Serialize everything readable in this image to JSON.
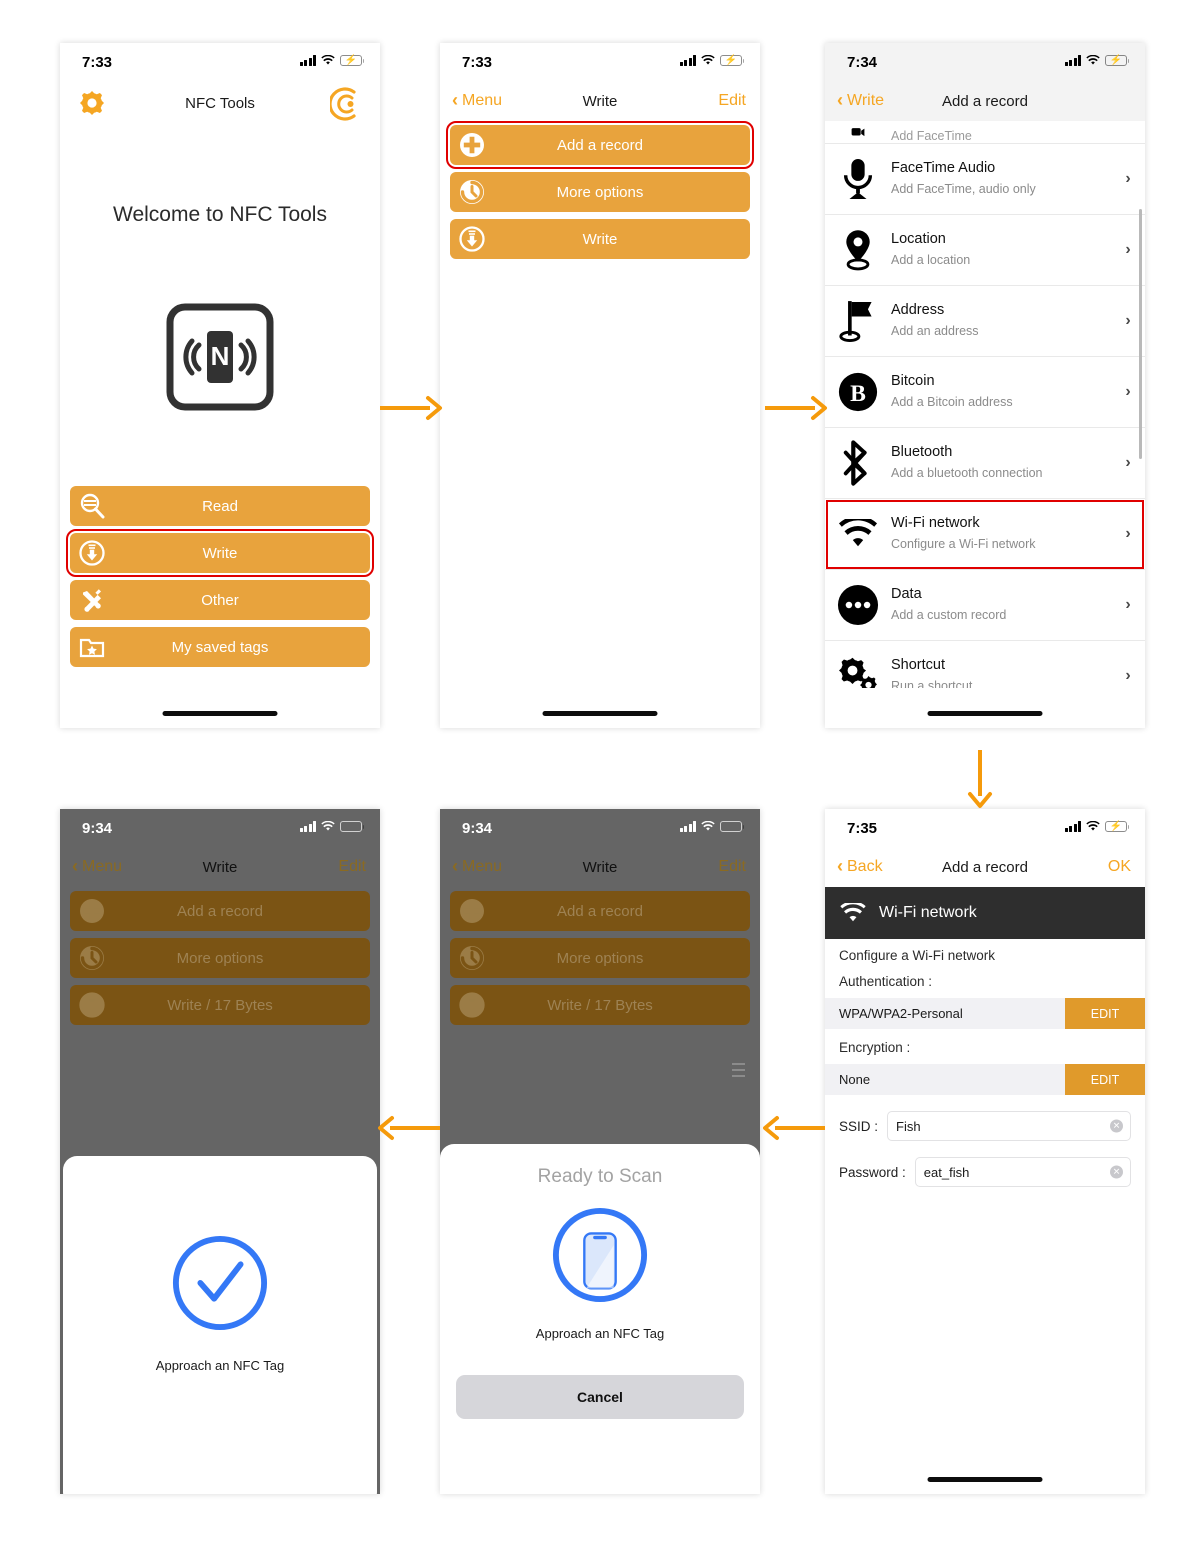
{
  "flow": {
    "arrows": [
      {
        "name": "arrow-screen1-to-screen2",
        "dir": "right"
      },
      {
        "name": "arrow-screen2-to-screen3",
        "dir": "right"
      },
      {
        "name": "arrow-screen3-to-screen4",
        "dir": "down"
      },
      {
        "name": "arrow-screen4-to-screen5",
        "dir": "left"
      },
      {
        "name": "arrow-screen5-to-screen6",
        "dir": "left"
      }
    ]
  },
  "screen1": {
    "status": {
      "time": "7:33",
      "signal_icon": "cellular-bars-icon",
      "wifi_icon": "wifi-icon",
      "battery_icon": "battery-charging-icon"
    },
    "gear_icon": "gear-icon",
    "brand_icon": "nfc-brand-icon",
    "app_title": "NFC Tools",
    "welcome": "Welcome to NFC Tools",
    "logo_icon": "nfc-tag-logo-icon",
    "logo_letter": "N",
    "buttons": [
      {
        "label": "Read",
        "icon": "magnifier-read-icon",
        "highlighted": false
      },
      {
        "label": "Write",
        "icon": "download-arrow-write-icon",
        "highlighted": true
      },
      {
        "label": "Other",
        "icon": "tools-wrench-screwdriver-icon",
        "highlighted": false
      },
      {
        "label": "My saved tags",
        "icon": "folder-star-icon",
        "highlighted": false
      }
    ]
  },
  "screen2": {
    "status": {
      "time": "7:33"
    },
    "nav": {
      "back": "Menu",
      "title": "Write",
      "right": "Edit"
    },
    "buttons": [
      {
        "label": "Add a record",
        "icon": "plus-circle-icon",
        "highlighted": true
      },
      {
        "label": "More options",
        "icon": "options-circle-icon",
        "highlighted": false
      },
      {
        "label": "Write",
        "icon": "download-arrow-write-icon",
        "highlighted": false
      }
    ]
  },
  "screen3": {
    "status": {
      "time": "7:34"
    },
    "nav": {
      "back": "Write",
      "title": "Add a record"
    },
    "partial_row": {
      "subtitle": "Add FaceTime"
    },
    "rows": [
      {
        "title": "FaceTime Audio",
        "subtitle": "Add FaceTime, audio only",
        "icon": "microphone-icon",
        "highlighted": false
      },
      {
        "title": "Location",
        "subtitle": "Add a location",
        "icon": "map-pin-icon",
        "highlighted": false
      },
      {
        "title": "Address",
        "subtitle": "Add an address",
        "icon": "flag-icon",
        "highlighted": false
      },
      {
        "title": "Bitcoin",
        "subtitle": "Add a Bitcoin address",
        "icon": "bitcoin-icon",
        "highlighted": false
      },
      {
        "title": "Bluetooth",
        "subtitle": "Add a bluetooth connection",
        "icon": "bluetooth-icon",
        "highlighted": false
      },
      {
        "title": "Wi-Fi network",
        "subtitle": "Configure a Wi-Fi network",
        "icon": "wifi-icon",
        "highlighted": true
      },
      {
        "title": "Data",
        "subtitle": "Add a custom record",
        "icon": "ellipsis-circle-icon",
        "highlighted": false
      },
      {
        "title": "Shortcut",
        "subtitle": "Run a shortcut",
        "icon": "gears-icon",
        "highlighted": false
      }
    ],
    "chevron": "›"
  },
  "screen4": {
    "status": {
      "time": "7:35"
    },
    "nav": {
      "back": "Back",
      "title": "Add a record",
      "right": "OK"
    },
    "header": {
      "icon": "wifi-icon",
      "title": "Wi-Fi network"
    },
    "description": "Configure a Wi-Fi network",
    "auth_label": "Authentication :",
    "auth_value": "WPA/WPA2-Personal",
    "auth_edit": "EDIT",
    "encryption_label": "Encryption :",
    "encryption_value": "None",
    "encryption_edit": "EDIT",
    "ssid_label": "SSID :",
    "ssid_value": "Fish",
    "password_label": "Password :",
    "password_value": "eat_fish",
    "clear_icon": "clear-field-icon"
  },
  "screen5": {
    "status": {
      "time": "9:34",
      "battery_icon": "battery-full-icon"
    },
    "nav": {
      "back": "Menu",
      "title": "Write",
      "right": "Edit"
    },
    "buttons": [
      {
        "label": "Add a record",
        "icon": "plus-circle-icon"
      },
      {
        "label": "More options",
        "icon": "options-circle-icon"
      },
      {
        "label": "Write / 17 Bytes",
        "icon": "download-arrow-write-icon"
      }
    ],
    "list_icon": "list-lines-icon",
    "sheet": {
      "title": "Ready to Scan",
      "graphic_icon": "phone-in-circle-icon",
      "message": "Approach an NFC Tag",
      "cancel": "Cancel"
    }
  },
  "screen6": {
    "status": {
      "time": "9:34",
      "battery_icon": "battery-full-icon"
    },
    "nav": {
      "back": "Menu",
      "title": "Write",
      "right": "Edit"
    },
    "buttons": [
      {
        "label": "Add a record",
        "icon": "plus-circle-icon"
      },
      {
        "label": "More options",
        "icon": "options-circle-icon"
      },
      {
        "label": "Write / 17 Bytes",
        "icon": "download-arrow-write-icon"
      }
    ],
    "sheet": {
      "graphic_icon": "checkmark-in-circle-icon",
      "message": "Approach an NFC Tag"
    }
  },
  "colors": {
    "accent_orange": "#E8A33D",
    "nav_orange": "#F5A623",
    "highlight_red": "#E00000",
    "ios_blue": "#3478F6",
    "dim_gray": "#656565",
    "dark_header": "#2E2E2E"
  }
}
